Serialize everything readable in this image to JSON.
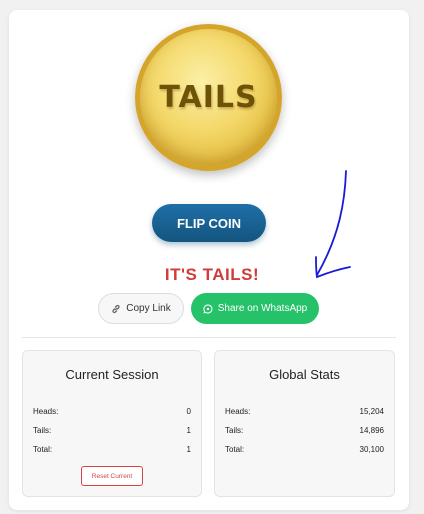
{
  "coin": {
    "face_text": "TAILS"
  },
  "controls": {
    "flip_label": "FLIP COIN",
    "result_text": "IT'S TAILS!",
    "copy_link_label": "Copy Link",
    "share_whatsapp_label": "Share on WhatsApp"
  },
  "session": {
    "title": "Current Session",
    "rows": [
      {
        "label": "Heads:",
        "value": "0"
      },
      {
        "label": "Tails:",
        "value": "1"
      },
      {
        "label": "Total:",
        "value": "1"
      }
    ],
    "reset_label": "Reset Current"
  },
  "global": {
    "title": "Global Stats",
    "rows": [
      {
        "label": "Heads:",
        "value": "15,204"
      },
      {
        "label": "Tails:",
        "value": "14,896"
      },
      {
        "label": "Total:",
        "value": "30,100"
      }
    ]
  },
  "icons": {
    "copy": "link-icon",
    "share": "whatsapp-icon"
  },
  "colors": {
    "accent_blue": "#1a5f8f",
    "result_red": "#d13b3b",
    "whatsapp_green": "#26c26a",
    "coin_gold": "#e9c54e"
  }
}
